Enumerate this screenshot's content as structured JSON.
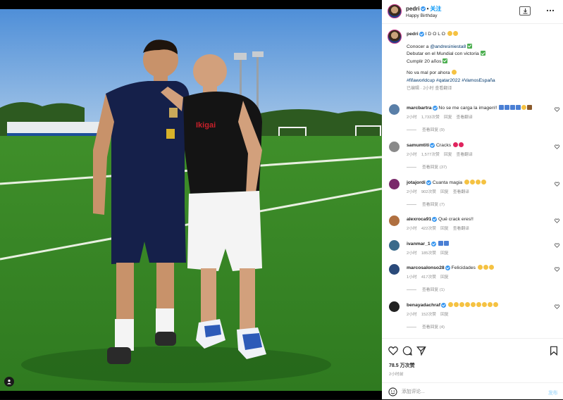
{
  "header": {
    "username": "pedri",
    "follow_label": "关注",
    "subtitle": "Happy Birthday",
    "dot": "•"
  },
  "caption": {
    "username": "pedri",
    "title": "I D O L O",
    "lines": [
      {
        "pre": "Conocer a ",
        "tag": "@andresiniesta8",
        "post": ""
      },
      {
        "pre": "Debutar en el Mundial con victoria",
        "tag": "",
        "post": ""
      },
      {
        "pre": "Cumplir 20 años",
        "tag": "",
        "post": ""
      }
    ],
    "closing": "No va mal por ahora",
    "hashtags": "#fifaworldcup #qatar2022 #VamosEspaña",
    "meta": "已编辑 · 2小时 查看翻译"
  },
  "comments": [
    {
      "user": "marcbartra",
      "text": "No se me carga la imagen!!",
      "time": "2小时",
      "likes": "1,733次赞",
      "reply": "回复",
      "translate": "查看翻译",
      "replies": "查看回复 (9)",
      "avatar_color": "#5a7fa8"
    },
    {
      "user": "samumtiti",
      "text": "Cracks",
      "time": "2小时",
      "likes": "1,577次赞",
      "reply": "回复",
      "translate": "查看翻译",
      "replies": "查看回复 (37)",
      "avatar_color": "#8a8a8a"
    },
    {
      "user": "jotajordi",
      "text": "Cuanta magia",
      "time": "2小时",
      "likes": "902次赞",
      "reply": "回复",
      "translate": "查看翻译",
      "replies": "查看回复 (7)",
      "avatar_color": "#7a2a6a"
    },
    {
      "user": "alexroca91",
      "text": "Qué crack eres!!",
      "time": "2小时",
      "likes": "422次赞",
      "reply": "回复",
      "translate": "查看翻译",
      "replies": "",
      "avatar_color": "#b07040"
    },
    {
      "user": "ivanmar_1",
      "text": "",
      "time": "2小时",
      "likes": "185次赞",
      "reply": "回复",
      "translate": "",
      "replies": "",
      "avatar_color": "#3a6a8a"
    },
    {
      "user": "marcosalonso28",
      "text": "Felicidades",
      "time": "1小时",
      "likes": "417次赞",
      "reply": "回复",
      "translate": "",
      "replies": "查看回复 (1)",
      "avatar_color": "#2a4a7a"
    },
    {
      "user": "benayadachraf",
      "text": "",
      "time": "2小时",
      "likes": "152次赞",
      "reply": "回复",
      "translate": "",
      "replies": "查看回复 (4)",
      "avatar_color": "#222222"
    }
  ],
  "actions": {
    "likes": "78.5 万次赞",
    "posted": "2小时前"
  },
  "add_comment": {
    "placeholder": "添加评论...",
    "post_label": "发布"
  },
  "colors": {
    "accent": "#0095f6",
    "verified": "#3897f0",
    "meta_gray": "#8e8e8e"
  },
  "icons": {
    "download": "download-icon",
    "more": "more-icon",
    "like": "heart-icon",
    "comment": "comment-icon",
    "share": "share-icon",
    "save": "bookmark-icon",
    "emoji": "emoji-icon",
    "user_tag": "user-tag-icon"
  }
}
